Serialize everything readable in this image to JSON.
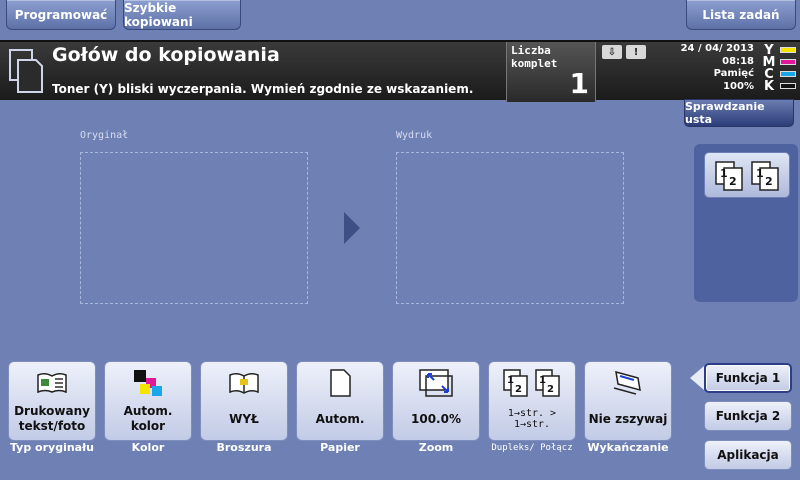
{
  "top_bar": {
    "programowac": "Programować",
    "szybkie": "Szybkie kopiowani",
    "lista": "Lista zadań"
  },
  "header": {
    "title": "Gołów do kopiowania",
    "message": "Toner (Y) bliski wyczerpania. Wymień zgodnie ze wskazaniem.",
    "count_label": "Liczba komplet",
    "count_value": "1",
    "date": "24 / 04/ 2013",
    "time": "08:18",
    "memory_label": "Pamięć",
    "memory_value": "100%",
    "toner": [
      {
        "letter": "Y",
        "color": "#f4e400"
      },
      {
        "letter": "M",
        "color": "#e0189a"
      },
      {
        "letter": "C",
        "color": "#1aa6e8"
      },
      {
        "letter": "K",
        "color": "#111111"
      }
    ]
  },
  "check_settings": "Sprawdzanie usta",
  "preview": {
    "original_label": "Oryginał",
    "output_label": "Wydruk"
  },
  "tiles": [
    {
      "value": "Drukowany tekst/foto",
      "caption": "Typ oryginału",
      "icon": "text-photo-icon"
    },
    {
      "value": "Autom. kolor",
      "caption": "Kolor",
      "icon": "color-squares-icon"
    },
    {
      "value": "WYŁ",
      "caption": "Broszura",
      "icon": "booklet-icon"
    },
    {
      "value": "Autom.",
      "caption": "Papier",
      "icon": "paper-icon"
    },
    {
      "value": "100.0%",
      "caption": "Zoom",
      "icon": "zoom-icon"
    },
    {
      "value": "1→str. > 1→str.",
      "caption": "Dupleks/ Połącz",
      "icon": "duplex-icon"
    },
    {
      "value": "Nie zszywaj",
      "caption": "Wykańczanie",
      "icon": "finishing-icon"
    }
  ],
  "side": {
    "funkcja1": "Funkcja 1",
    "funkcja2": "Funkcja 2",
    "aplikacja": "Aplikacja"
  }
}
